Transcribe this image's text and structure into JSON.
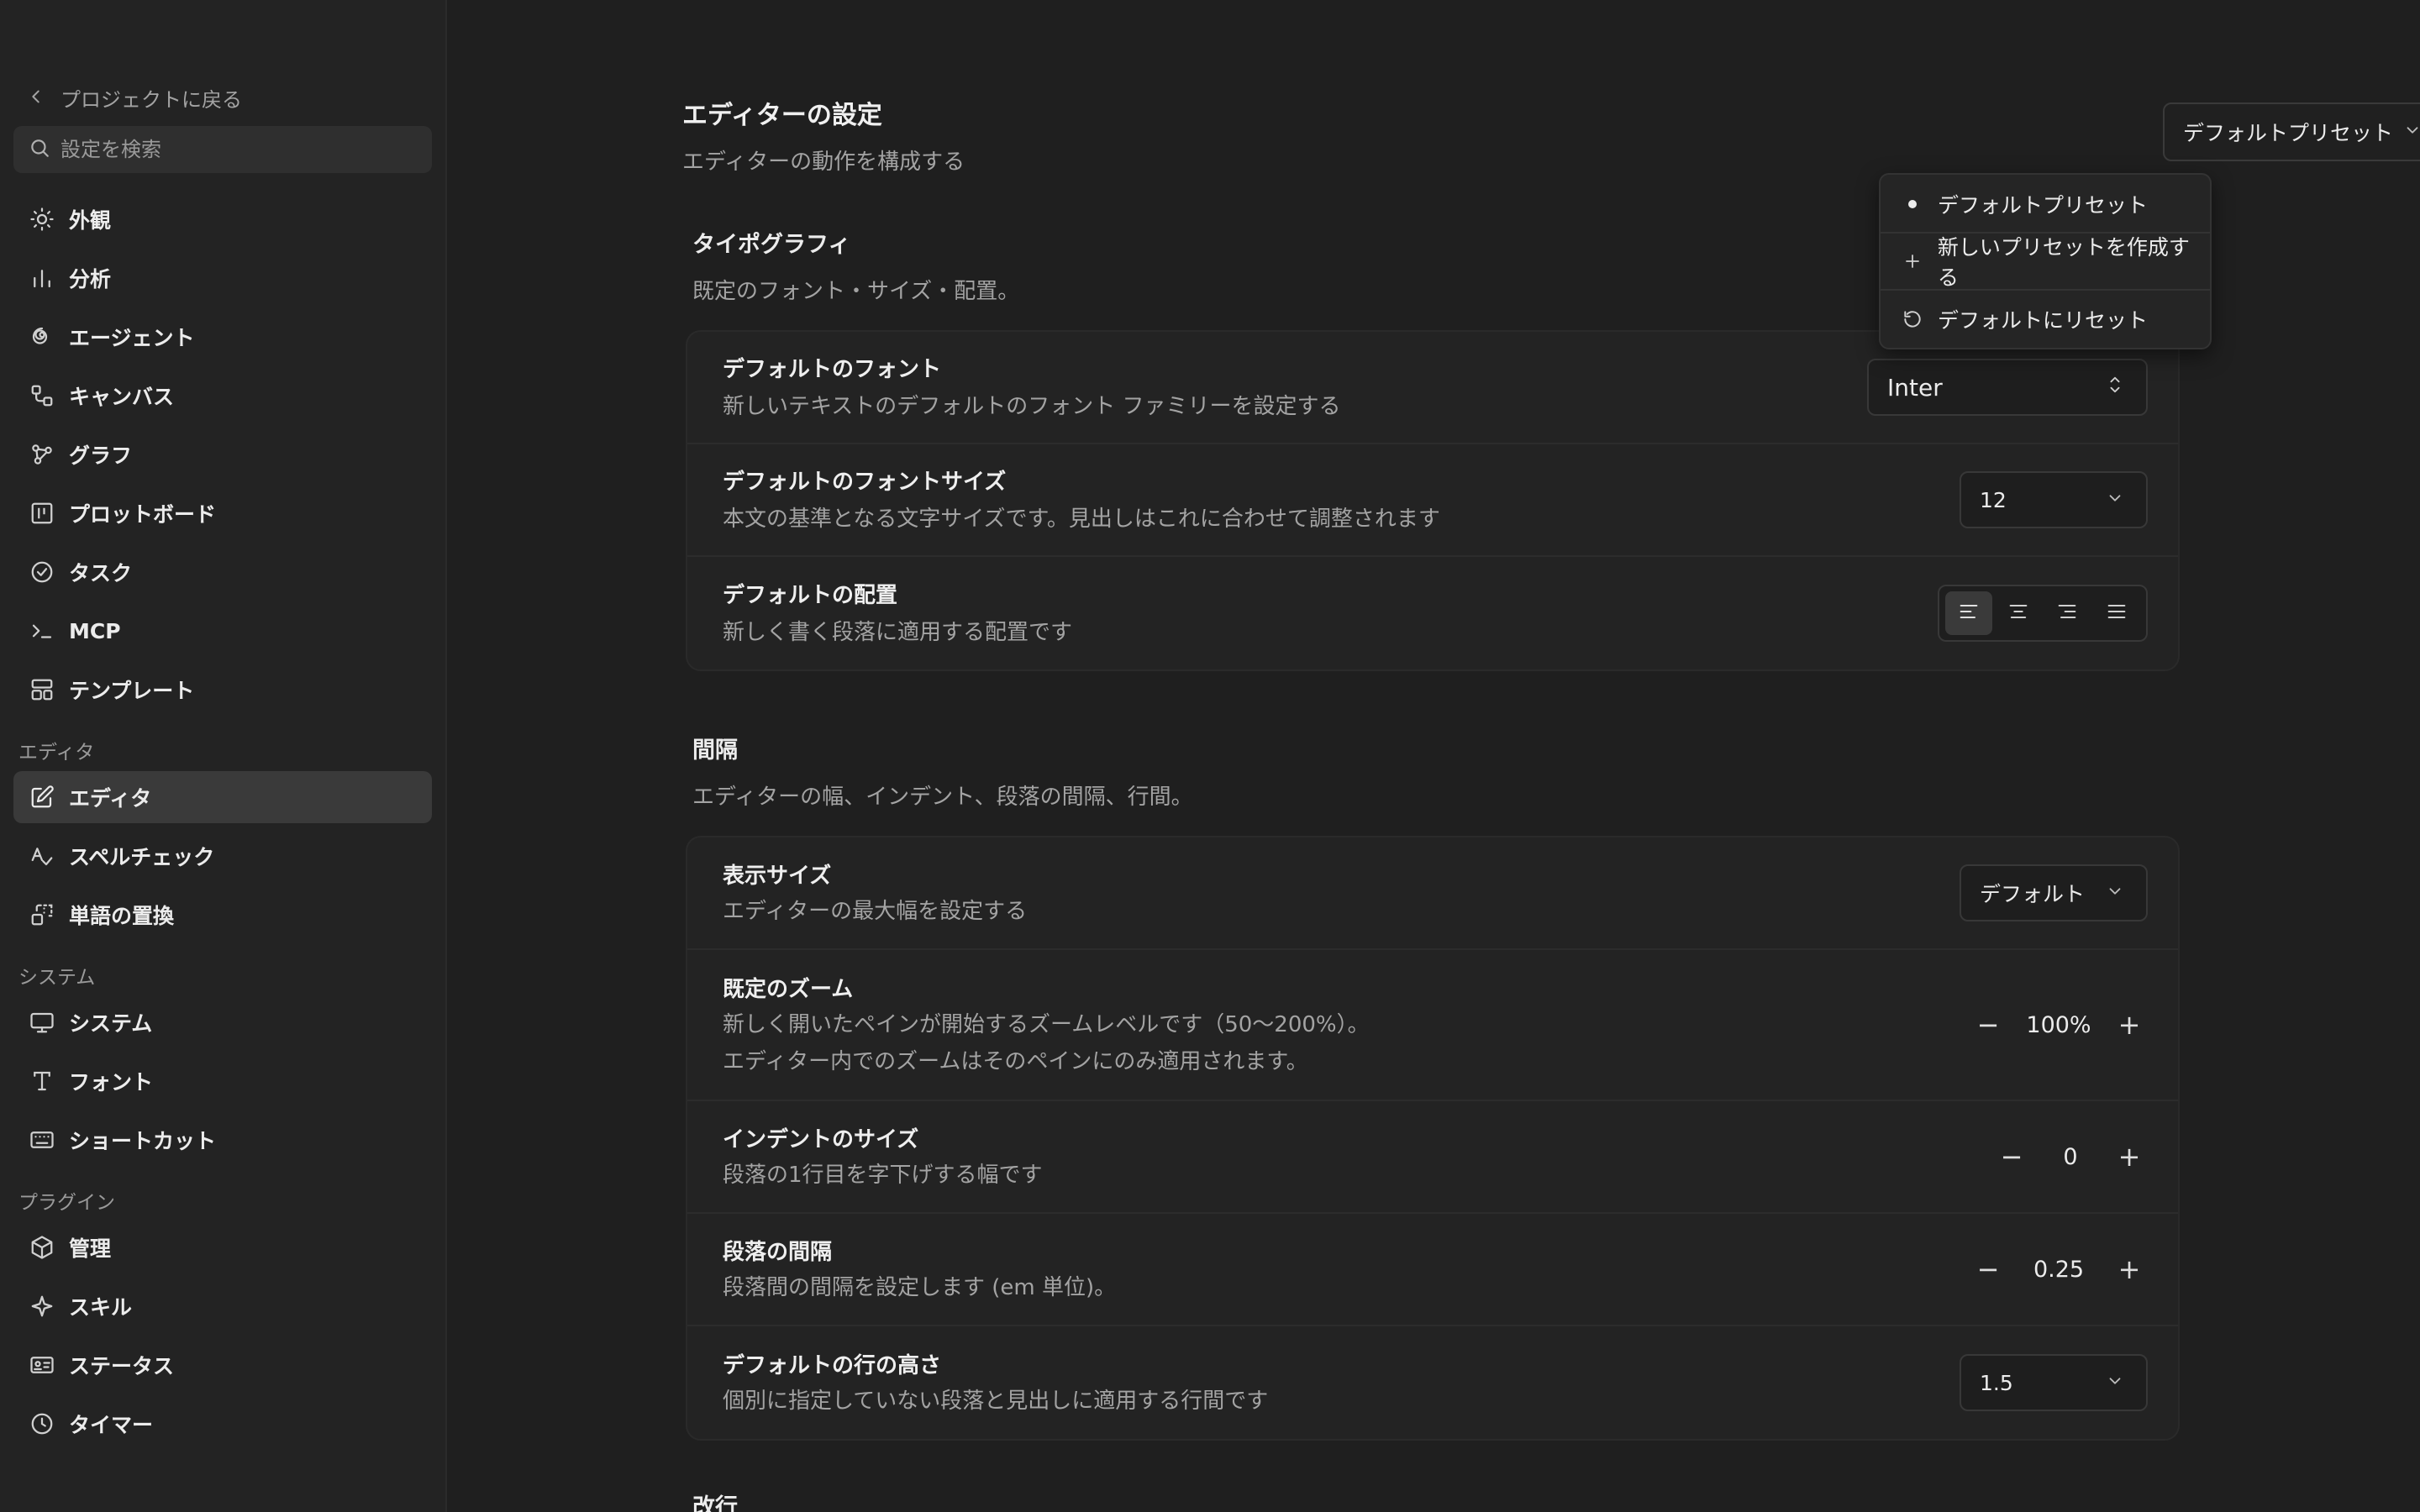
{
  "sidebar": {
    "back_label": "プロジェクトに戻る",
    "search_placeholder": "設定を検索",
    "items_top": [
      {
        "label": "外観",
        "icon": "sun-icon"
      },
      {
        "label": "分析",
        "icon": "bar-chart-icon"
      },
      {
        "label": "エージェント",
        "icon": "spiral-icon"
      },
      {
        "label": "キャンバス",
        "icon": "canvas-icon"
      },
      {
        "label": "グラフ",
        "icon": "graph-icon"
      },
      {
        "label": "プロットボード",
        "icon": "board-icon"
      },
      {
        "label": "タスク",
        "icon": "check-circle-icon"
      },
      {
        "label": "MCP",
        "icon": "terminal-icon"
      },
      {
        "label": "テンプレート",
        "icon": "template-icon"
      }
    ],
    "section_editor": "エディタ",
    "items_editor": [
      {
        "label": "エディタ",
        "icon": "edit-icon",
        "active": true
      },
      {
        "label": "スペルチェック",
        "icon": "spellcheck-icon"
      },
      {
        "label": "単語の置換",
        "icon": "replace-icon"
      }
    ],
    "section_system": "システム",
    "items_system": [
      {
        "label": "システム",
        "icon": "monitor-icon"
      },
      {
        "label": "フォント",
        "icon": "type-icon"
      },
      {
        "label": "ショートカット",
        "icon": "keyboard-icon"
      }
    ],
    "section_plugins": "プラグイン",
    "items_plugins": [
      {
        "label": "管理",
        "icon": "package-icon"
      },
      {
        "label": "スキル",
        "icon": "sparkle-icon"
      },
      {
        "label": "ステータス",
        "icon": "id-card-icon"
      },
      {
        "label": "タイマー",
        "icon": "clock-icon"
      }
    ]
  },
  "header": {
    "title": "エディターの設定",
    "subtitle": "エディターの動作を構成する",
    "preset_selected": "デフォルトプリセット"
  },
  "preset_menu": {
    "items": [
      {
        "label": "デフォルトプリセット",
        "icon": "dot-icon"
      },
      {
        "label": "新しいプリセットを作成する",
        "icon": "plus-icon"
      },
      {
        "label": "デフォルトにリセット",
        "icon": "reset-icon"
      }
    ]
  },
  "typography": {
    "title": "タイポグラフィ",
    "subtitle": "既定のフォント・サイズ・配置。",
    "font": {
      "label": "デフォルトのフォント",
      "desc": "新しいテキストのデフォルトのフォント ファミリーを設定する",
      "value": "Inter"
    },
    "font_size": {
      "label": "デフォルトのフォントサイズ",
      "desc": "本文の基準となる文字サイズです。見出しはこれに合わせて調整されます",
      "value": "12"
    },
    "alignment": {
      "label": "デフォルトの配置",
      "desc": "新しく書く段落に適用する配置です",
      "selected": "left"
    }
  },
  "spacing": {
    "title": "間隔",
    "subtitle": "エディターの幅、インデント、段落の間隔、行間。",
    "display_size": {
      "label": "表示サイズ",
      "desc": "エディターの最大幅を設定する",
      "value": "デフォルト"
    },
    "zoom": {
      "label": "既定のズーム",
      "desc1": "新しく開いたペインが開始するズームレベルです（50〜200%）。",
      "desc2": "エディター内でのズームはそのペインにのみ適用されます。",
      "value": "100%"
    },
    "indent": {
      "label": "インデントのサイズ",
      "desc": "段落の1行目を字下げする幅です",
      "value": "0"
    },
    "paragraph_spacing": {
      "label": "段落の間隔",
      "desc": "段落間の間隔を設定します (em 単位)。",
      "value": "0.25"
    },
    "line_height": {
      "label": "デフォルトの行の高さ",
      "desc": "個別に指定していない段落と見出しに適用する行間です",
      "value": "1.5"
    }
  },
  "next_section_title": "改行"
}
